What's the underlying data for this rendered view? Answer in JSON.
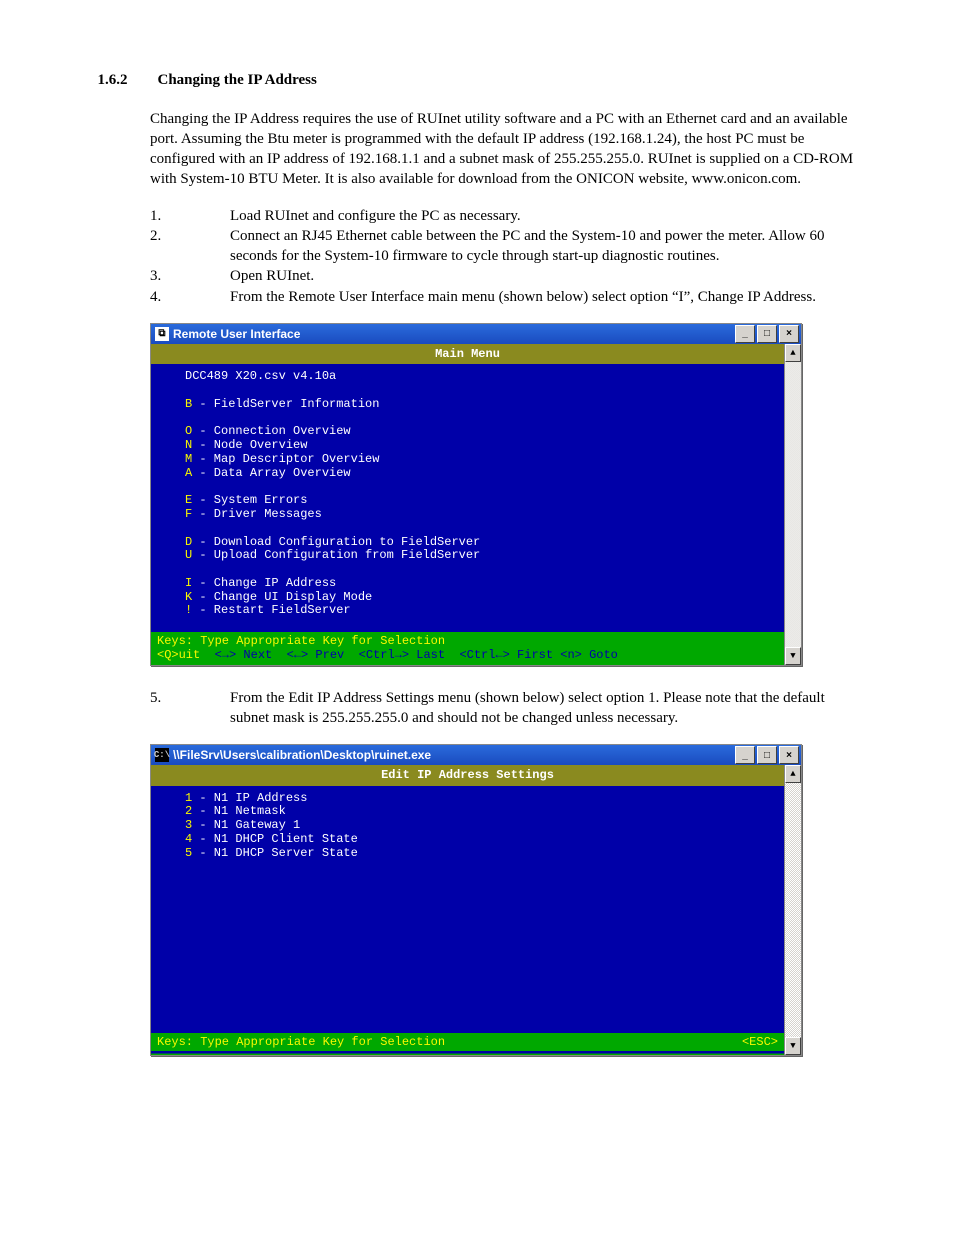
{
  "heading": {
    "number": "1.6.2",
    "title": "Changing the IP Address"
  },
  "paragraph1": "Changing the IP Address requires the use of RUInet utility software and a PC with an Ethernet card and an available port. Assuming the Btu meter is programmed with the default IP address (192.168.1.24), the host PC must be configured with an IP address of 192.168.1.1 and a subnet mask of 255.255.255.0. RUInet is supplied on a CD-ROM with System-10 BTU Meter. It is also available for download from the ONICON website, www.onicon.com.",
  "steps_a": [
    {
      "n": "1.",
      "t": "Load RUInet and configure the PC as necessary."
    },
    {
      "n": "2.",
      "t": "Connect an RJ45 Ethernet cable between the PC and the System-10 and power the meter. Allow 60 seconds for the System-10 firmware to cycle through start-up diagnostic routines."
    },
    {
      "n": "3.",
      "t": "Open RUInet."
    },
    {
      "n": "4.",
      "t": "From the Remote User Interface main menu (shown below) select option “I”, Change IP Address."
    }
  ],
  "win1": {
    "title": "Remote User Interface",
    "menubar": "Main Menu",
    "version": "DCC489 X20.csv v4.10a",
    "items": [
      {
        "k": "B",
        "t": "FieldServer Information"
      },
      {
        "gap": true
      },
      {
        "k": "O",
        "t": "Connection Overview"
      },
      {
        "k": "N",
        "t": "Node Overview"
      },
      {
        "k": "M",
        "t": "Map Descriptor Overview"
      },
      {
        "k": "A",
        "t": "Data Array Overview"
      },
      {
        "gap": true
      },
      {
        "k": "E",
        "t": "System Errors"
      },
      {
        "k": "F",
        "t": "Driver Messages"
      },
      {
        "gap": true
      },
      {
        "k": "D",
        "t": "Download Configuration to FieldServer"
      },
      {
        "k": "U",
        "t": "Upload Configuration from FieldServer"
      },
      {
        "gap": true
      },
      {
        "k": "I",
        "t": "Change IP Address"
      },
      {
        "k": "K",
        "t": "Change UI Display Mode"
      },
      {
        "k": "!",
        "t": "Restart FieldServer"
      }
    ],
    "footer1": "Keys: Type Appropriate Key for Selection",
    "footer2a": "<Q>uit  ",
    "footer2b": "<→> Next  <←> Prev  <Ctrl→> Last  <Ctrl←> First <n> Goto"
  },
  "steps_b": [
    {
      "n": "5.",
      "t": "From the Edit IP Address Settings menu (shown below) select option 1. Please note that the default subnet mask is 255.255.255.0 and should not be changed unless necessary."
    }
  ],
  "win2": {
    "title": "\\\\FileSrv\\Users\\calibration\\Desktop\\ruinet.exe",
    "menubar": "Edit IP Address Settings",
    "items": [
      {
        "k": "1",
        "t": "N1 IP Address"
      },
      {
        "k": "2",
        "t": "N1 Netmask"
      },
      {
        "k": "3",
        "t": "N1 Gateway 1"
      },
      {
        "k": "4",
        "t": "N1 DHCP Client State"
      },
      {
        "k": "5",
        "t": "N1 DHCP Server State"
      }
    ],
    "footer1": "Keys: Type Appropriate Key for Selection",
    "footer_right": "<ESC>"
  },
  "ui": {
    "min": "_",
    "max": "□",
    "close": "×",
    "up": "▲",
    "down": "▼"
  }
}
